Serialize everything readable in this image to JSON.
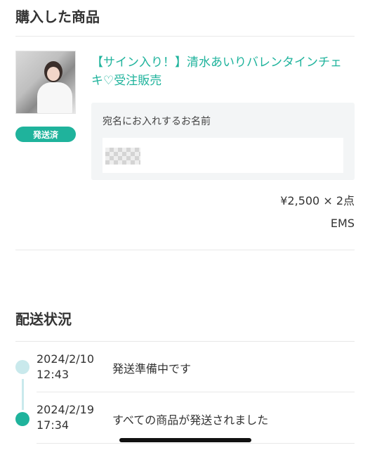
{
  "purchased": {
    "title": "購入した商品",
    "status_badge": "発送済",
    "product_title": "【サイン入り！】清水あいりバレンタインチェキ♡受注販売",
    "recipient_label": "宛名にお入れするお名前",
    "price_qty": "¥2,500 × 2点",
    "shipping_method": "EMS"
  },
  "shipping": {
    "title": "配送状況",
    "events": [
      {
        "date": "2024/2/10",
        "time": "12:43",
        "status": "発送準備中です"
      },
      {
        "date": "2024/2/19",
        "time": "17:34",
        "status": "すべての商品が発送されました"
      }
    ]
  },
  "colors": {
    "accent": "#1fb39c",
    "timeline_past": "#c9e9ec",
    "timeline_current": "#1fb39c"
  }
}
